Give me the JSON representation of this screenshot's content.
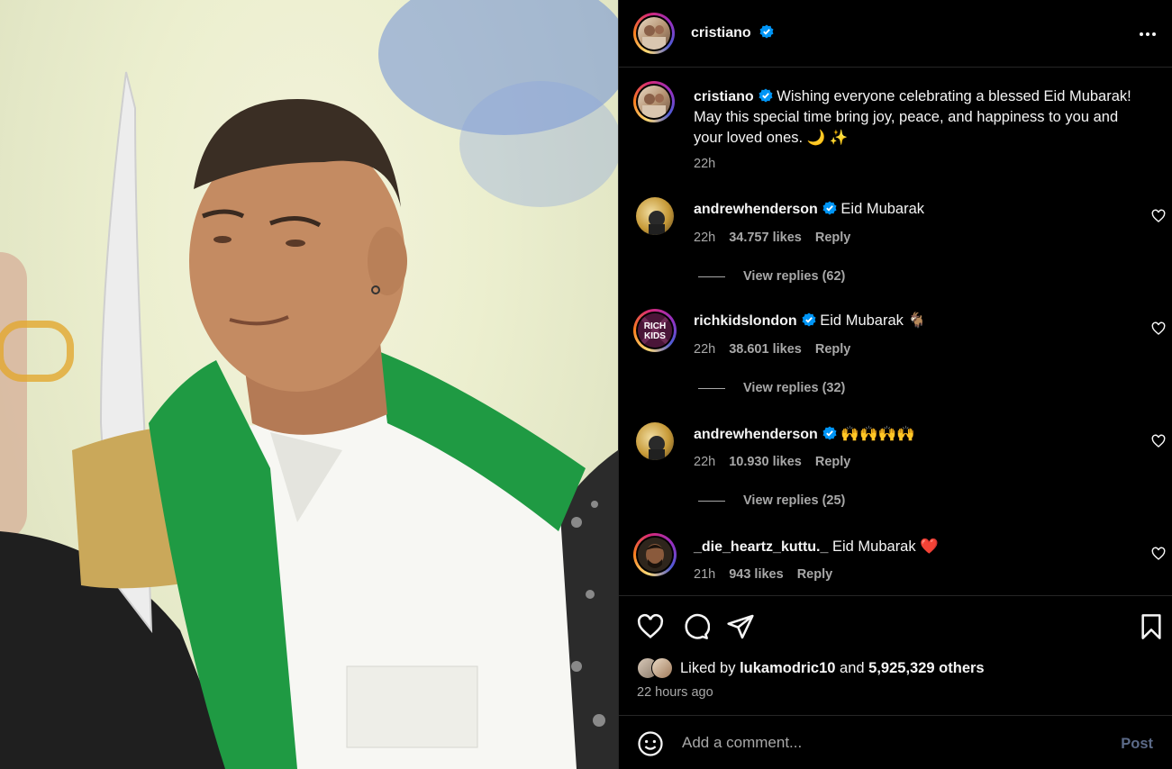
{
  "header": {
    "username": "cristiano"
  },
  "caption": {
    "username": "cristiano",
    "text": "Wishing everyone celebrating a blessed Eid Mubarak! May this special time bring joy, peace, and happiness to you and your loved ones. 🌙 ✨",
    "time": "22h"
  },
  "comments": [
    {
      "username": "andrewhenderson",
      "verified": true,
      "text": "Eid Mubarak",
      "time": "22h",
      "likes": "34.757 likes",
      "reply": "Reply",
      "view_replies": "View replies (62)"
    },
    {
      "username": "richkidslondon",
      "verified": true,
      "text": "Eid Mubarak 🐐",
      "time": "22h",
      "likes": "38.601 likes",
      "reply": "Reply",
      "view_replies": "View replies (32)"
    },
    {
      "username": "andrewhenderson",
      "verified": true,
      "text": "🙌🙌🙌🙌",
      "time": "22h",
      "likes": "10.930 likes",
      "reply": "Reply",
      "view_replies": "View replies (25)"
    },
    {
      "username": "_die_heartz_kuttu._",
      "verified": false,
      "text": "Eid Mubarak ❤️",
      "time": "21h",
      "likes": "943 likes",
      "reply": "Reply"
    }
  ],
  "likes": {
    "prefix": "Liked by",
    "user": "lukamodric10",
    "and": "and",
    "others": "5,925,329 others"
  },
  "time_ago": "22 hours ago",
  "add_comment": {
    "placeholder": "Add a comment...",
    "post_label": "Post"
  },
  "colors": {
    "verified": "#0095f6",
    "post_disabled": "#5b6a88",
    "muted": "#a8a8a8"
  },
  "icons": [
    "more-options-icon",
    "heart-icon",
    "comment-icon",
    "share-icon",
    "bookmark-icon",
    "emoji-icon",
    "verified-icon"
  ]
}
